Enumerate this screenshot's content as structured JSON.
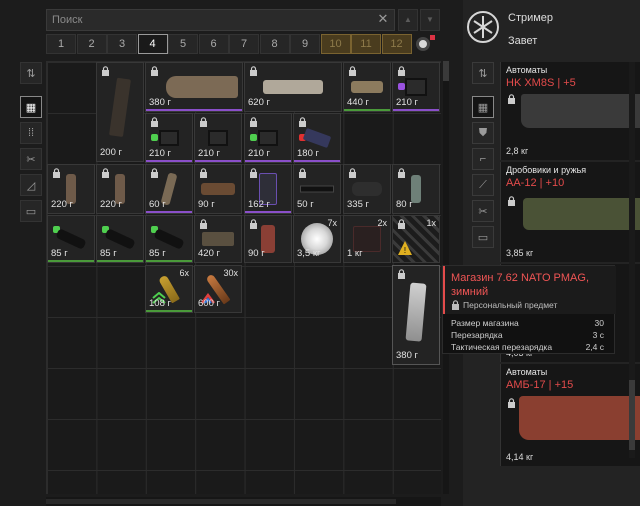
{
  "search": {
    "placeholder": "Поиск"
  },
  "pages": [
    "1",
    "2",
    "3",
    "4",
    "5",
    "6",
    "7",
    "8",
    "9",
    "10",
    "11",
    "12"
  ],
  "active_page": "4",
  "stash": {
    "items": [
      {
        "weight": "200 г"
      },
      {
        "weight": "380 г"
      },
      {
        "weight": "620 г"
      },
      {
        "weight": "440 г"
      },
      {
        "weight": "210 г"
      },
      {
        "weight": "210 г"
      },
      {
        "weight": "210 г"
      },
      {
        "weight": "210 г"
      },
      {
        "weight": "180 г"
      },
      {
        "weight": "220 г"
      },
      {
        "weight": "220 г"
      },
      {
        "weight": "60 г"
      },
      {
        "weight": "90 г"
      },
      {
        "weight": "162 г"
      },
      {
        "weight": "50 г"
      },
      {
        "weight": "335 г"
      },
      {
        "weight": "80 г"
      },
      {
        "weight": "85 г"
      },
      {
        "weight": "85 г"
      },
      {
        "weight": "85 г"
      },
      {
        "weight": "420 г"
      },
      {
        "weight": "90 г"
      },
      {
        "weight": "3,5 кг",
        "count": "7x"
      },
      {
        "weight": "1 кг",
        "count": "2x"
      },
      {
        "weight": "",
        "count": "1x"
      },
      {
        "weight": "108 г",
        "count": "6x"
      },
      {
        "weight": "600 г",
        "count": "30x"
      },
      {
        "weight": "380 г"
      }
    ]
  },
  "trader": {
    "name": "Стример",
    "subtitle": "Завет"
  },
  "trader_items": [
    {
      "category": "Автоматы",
      "name": "HK XM8S | +5",
      "weight": "2,8 кг"
    },
    {
      "category": "Дробовики и ружья",
      "name": "AA-12 | +10",
      "weight": "3,85 кг"
    },
    {
      "category": "",
      "name": "",
      "weight": "4,03 кг"
    },
    {
      "category": "Автоматы",
      "name": "АМБ-17 | +15",
      "weight": "4,14 кг"
    }
  ],
  "tooltip": {
    "title": "Магазин 7.62 NATO PMAG, зимний",
    "personal": "Персональный предмет",
    "stats": [
      {
        "label": "Размер магазина",
        "value": "30"
      },
      {
        "label": "Перезарядка",
        "value": "3 с"
      },
      {
        "label": "Тактическая перезарядка",
        "value": "2,4 с"
      }
    ]
  },
  "colors": {
    "accent": "#e34b4b",
    "rarity_purple": "#8a4fc9",
    "rarity_green": "#4a9a3a",
    "locked_tab": "#4a3c1e"
  },
  "icons": [
    "search-clear-icon",
    "sort-up-icon",
    "sort-down-icon",
    "lock-icon",
    "grid-view-icon",
    "filter-icon",
    "wrench-icon",
    "ammo-icon",
    "chest-icon",
    "trader-logo-icon"
  ]
}
